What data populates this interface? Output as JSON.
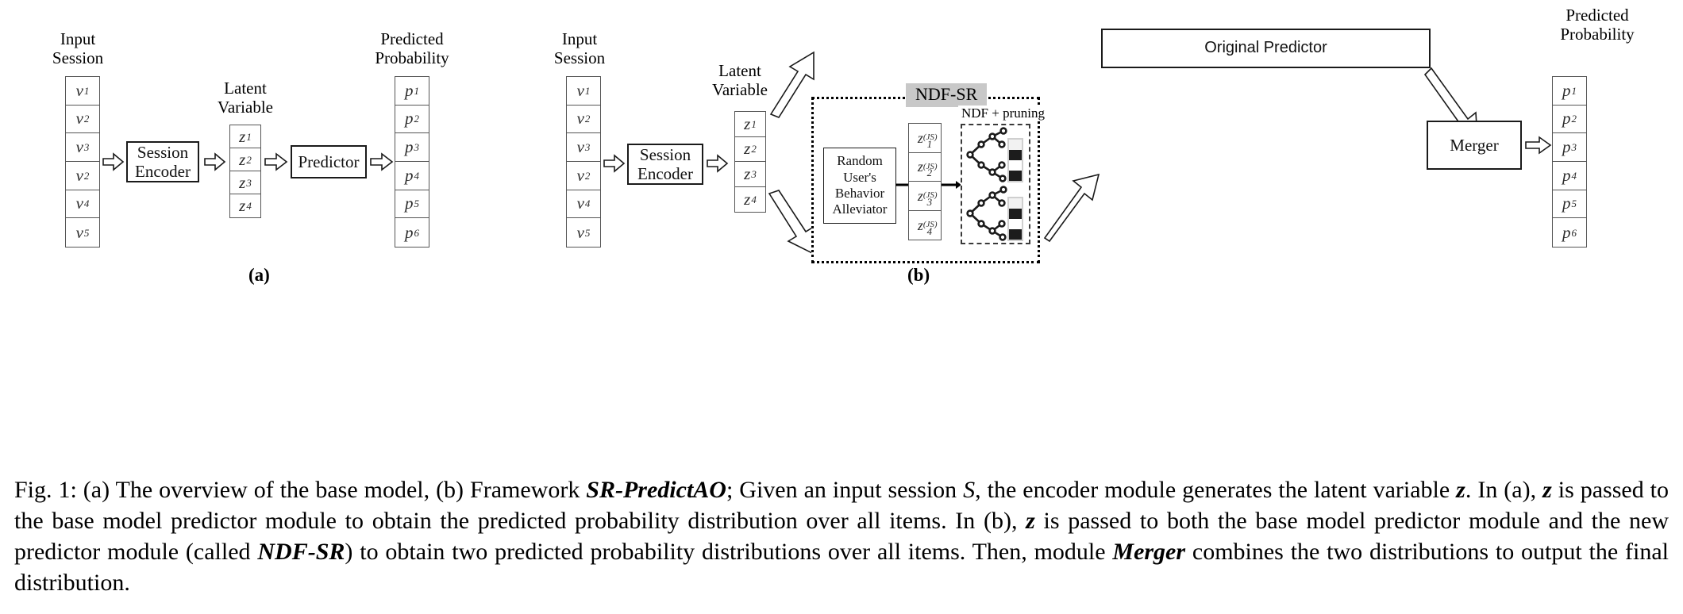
{
  "figure": {
    "subfigure_a_label": "(a)",
    "subfigure_b_label": "(b)",
    "panel_a": {
      "input_session_label": "Input\nSession",
      "latent_variable_label": "Latent\nVariable",
      "predicted_probability_label": "Predicted\nProbability",
      "input_session_cells": [
        "v1",
        "v2",
        "v3",
        "v2",
        "v4",
        "v5"
      ],
      "input_session_cells_text": [
        {
          "base": "v",
          "sub": "1"
        },
        {
          "base": "v",
          "sub": "2"
        },
        {
          "base": "v",
          "sub": "3"
        },
        {
          "base": "v",
          "sub": "2"
        },
        {
          "base": "v",
          "sub": "4"
        },
        {
          "base": "v",
          "sub": "5"
        }
      ],
      "latent_cells_text": [
        {
          "base": "z",
          "sub": "1"
        },
        {
          "base": "z",
          "sub": "2"
        },
        {
          "base": "z",
          "sub": "3"
        },
        {
          "base": "z",
          "sub": "4"
        }
      ],
      "probability_cells_text": [
        {
          "base": "p",
          "sub": "1"
        },
        {
          "base": "p",
          "sub": "2"
        },
        {
          "base": "p",
          "sub": "3"
        },
        {
          "base": "p",
          "sub": "4"
        },
        {
          "base": "p",
          "sub": "5"
        },
        {
          "base": "p",
          "sub": "6"
        }
      ],
      "session_encoder_label": "Session\nEncoder",
      "predictor_label": "Predictor"
    },
    "panel_b": {
      "input_session_label": "Input\nSession",
      "latent_variable_label": "Latent\nVariable",
      "predicted_probability_label": "Predicted\nProbability",
      "input_session_cells_text": [
        {
          "base": "v",
          "sub": "1"
        },
        {
          "base": "v",
          "sub": "2"
        },
        {
          "base": "v",
          "sub": "3"
        },
        {
          "base": "v",
          "sub": "2"
        },
        {
          "base": "v",
          "sub": "4"
        },
        {
          "base": "v",
          "sub": "5"
        }
      ],
      "latent_cells_text": [
        {
          "base": "z",
          "sub": "1"
        },
        {
          "base": "z",
          "sub": "2"
        },
        {
          "base": "z",
          "sub": "3"
        },
        {
          "base": "z",
          "sub": "4"
        }
      ],
      "js_latent_cells_text": [
        {
          "base": "z",
          "sub": "1",
          "sup": "(JS)"
        },
        {
          "base": "z",
          "sub": "2",
          "sup": "(JS)"
        },
        {
          "base": "z",
          "sub": "3",
          "sup": "(JS)"
        },
        {
          "base": "z",
          "sub": "4",
          "sup": "(JS)"
        }
      ],
      "probability_cells_text": [
        {
          "base": "p",
          "sub": "1"
        },
        {
          "base": "p",
          "sub": "2"
        },
        {
          "base": "p",
          "sub": "3"
        },
        {
          "base": "p",
          "sub": "4"
        },
        {
          "base": "p",
          "sub": "5"
        },
        {
          "base": "p",
          "sub": "6"
        }
      ],
      "session_encoder_label": "Session\nEncoder",
      "original_predictor_label": "Original Predictor",
      "ndf_sr_label": "NDF-SR",
      "ndf_pruning_label": "NDF + pruning",
      "alleviator_label": "Random\nUser's\nBehavior\nAlleviator",
      "merger_label": "Merger"
    },
    "colors": {
      "ndf_sr_label_background": "#c8c8c8",
      "box_border": "#1a1a1a",
      "cell_border": "#555555",
      "dist_bar_frame": "#cfcfcf",
      "dist_dark": "#1c1c1c",
      "dist_light": "#ffffff",
      "dist_lightgray": "#f2f2f2"
    },
    "dist_bars": [
      {
        "segments": [
          "#f2f2f2",
          "#1c1c1c",
          "#ffffff",
          "#1c1c1c"
        ]
      },
      {
        "segments": [
          "#f2f2f2",
          "#1c1c1c",
          "#ffffff",
          "#1c1c1c"
        ]
      }
    ]
  },
  "caption": {
    "parts": [
      {
        "t": "Fig. 1: (a) The overview of the base model, (b) Framework ",
        "s": "n"
      },
      {
        "t": "SR-PredictAO",
        "s": "bi"
      },
      {
        "t": "; Given an input session ",
        "s": "n"
      },
      {
        "t": "S",
        "s": "i"
      },
      {
        "t": ", the encoder module generates the latent variable ",
        "s": "n"
      },
      {
        "t": "z",
        "s": "bi"
      },
      {
        "t": ". In (a), ",
        "s": "n"
      },
      {
        "t": "z",
        "s": "bi"
      },
      {
        "t": " is passed to the base model predictor module to obtain the predicted probability distribution over all items. In (b), ",
        "s": "n"
      },
      {
        "t": "z",
        "s": "bi"
      },
      {
        "t": " is passed to both the base model predictor module and the new predictor module (called ",
        "s": "n"
      },
      {
        "t": "NDF-SR",
        "s": "bi"
      },
      {
        "t": ") to obtain two predicted probability distributions over all items. Then, module ",
        "s": "n"
      },
      {
        "t": "Merger",
        "s": "bi"
      },
      {
        "t": " combines the two distributions to output the final distribution.",
        "s": "n"
      }
    ],
    "full_text": "Fig. 1: (a) The overview of the base model, (b) Framework SR-PredictAO; Given an input session S, the encoder module generates the latent variable z. In (a), z is passed to the base model predictor module to obtain the predicted probability distribution over all items. In (b), z is passed to both the base model predictor module and the new predictor module (called NDF-SR) to obtain two predicted probability distributions over all items. Then, module Merger combines the two distributions to output the final distribution."
  }
}
